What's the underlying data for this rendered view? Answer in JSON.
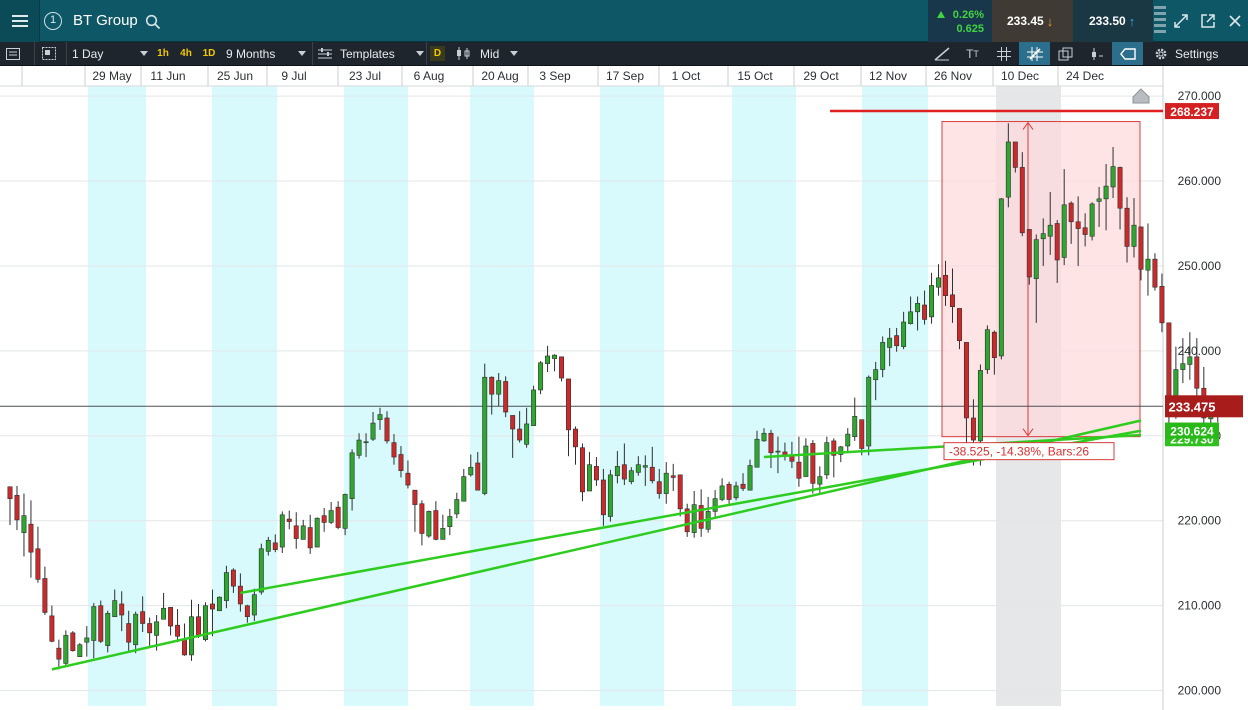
{
  "header": {
    "instrument": "BT Group",
    "link_badge": "1",
    "change_pct": "0.26%",
    "change_abs": "0.625",
    "sell_price": "233.45",
    "buy_price": "233.50",
    "icons": [
      "menu-icon",
      "link-icon",
      "search-icon",
      "grip-icon",
      "expand-icon",
      "popout-icon",
      "close-icon"
    ],
    "colors": {
      "header_bg": "#0d5766",
      "positive": "#42d442",
      "sell_bg": "#3f3a33",
      "buy_bg": "#1a3744"
    }
  },
  "toolbar": {
    "interval": "1 Day",
    "quick_intervals": [
      "1h",
      "4h",
      "1D"
    ],
    "range": "9 Months",
    "templates_label": "Templates",
    "price_type_badge": "D",
    "price_type": "Mid",
    "settings_label": "Settings",
    "tools": [
      "draw-line-icon",
      "text-size-icon",
      "grid-icon",
      "crosshair-icon",
      "layers-icon",
      "indicator-icon",
      "label-icon",
      "gear-icon"
    ]
  },
  "chart_data": {
    "type": "candlestick",
    "x_labels": [
      "29 May",
      "11 Jun",
      "25 Jun",
      "9 Jul",
      "23 Jul",
      "6 Aug",
      "20 Aug",
      "3 Sep",
      "17 Sep",
      "1 Oct",
      "15 Oct",
      "29 Oct",
      "12 Nov",
      "26 Nov",
      "10 Dec",
      "24 Dec"
    ],
    "y_ticks": [
      "270.000",
      "260.000",
      "250.000",
      "240.000",
      "230.000",
      "220.000",
      "210.000",
      "200.000"
    ],
    "ylim": [
      199.6,
      272.6
    ],
    "bars_total": 162,
    "current_price": 233.475,
    "current_price_label": "233.475",
    "colors": {
      "up": "#2fa62f",
      "down": "#cc2a2a",
      "band": "#d8fafd",
      "trendline": "#2ecc1e",
      "resistance": "#e02020",
      "measure_fill": "#ffd9dd",
      "measure_border": "#d83c3c"
    },
    "candles": [
      [
        224.0,
        224.0,
        219.5,
        222.6
      ],
      [
        223.0,
        224.1,
        218.9,
        220.1
      ],
      [
        218.6,
        223.2,
        215.8,
        220.6
      ],
      [
        219.6,
        222.4,
        213.3,
        216.3
      ],
      [
        216.7,
        219.3,
        212.7,
        213.1
      ],
      [
        213.2,
        214.6,
        208.9,
        209.2
      ],
      [
        208.8,
        210.0,
        205.7,
        205.8
      ],
      [
        205.0,
        206.0,
        202.5,
        203.7
      ],
      [
        203.2,
        207.1,
        202.8,
        206.5
      ],
      [
        206.8,
        207.0,
        204.6,
        204.7
      ],
      [
        204.0,
        205.6,
        204.6,
        205.4
      ],
      [
        205.7,
        207.6,
        204.0,
        206.2
      ],
      [
        205.9,
        210.3,
        203.8,
        209.9
      ],
      [
        210.0,
        210.6,
        205.6,
        205.8
      ],
      [
        205.3,
        209.4,
        204.5,
        209.1
      ],
      [
        208.7,
        211.9,
        209.4,
        210.6
      ],
      [
        210.2,
        211.7,
        207.0,
        208.9
      ],
      [
        207.9,
        209.4,
        204.7,
        205.7
      ],
      [
        205.4,
        209.3,
        204.4,
        209.0
      ],
      [
        209.3,
        211.1,
        206.9,
        207.9
      ],
      [
        207.9,
        208.6,
        205.0,
        206.8
      ],
      [
        206.5,
        208.9,
        204.7,
        208.1
      ],
      [
        208.4,
        211.5,
        208.4,
        209.7
      ],
      [
        209.8,
        209.8,
        206.5,
        207.6
      ],
      [
        207.7,
        209.6,
        205.7,
        206.4
      ],
      [
        206.1,
        207.9,
        204.1,
        204.2
      ],
      [
        204.2,
        210.7,
        203.5,
        208.7
      ],
      [
        208.7,
        210.2,
        206.2,
        206.4
      ],
      [
        206.0,
        210.4,
        205.8,
        210.0
      ],
      [
        210.2,
        211.9,
        206.4,
        209.6
      ],
      [
        209.4,
        211.1,
        209.9,
        211.0
      ],
      [
        210.6,
        214.7,
        209.7,
        213.9
      ],
      [
        214.2,
        214.4,
        211.5,
        212.3
      ],
      [
        212.3,
        213.8,
        209.3,
        210.2
      ],
      [
        210.0,
        210.1,
        208.0,
        208.7
      ],
      [
        208.9,
        212.0,
        208.2,
        211.3
      ],
      [
        211.6,
        217.3,
        211.3,
        216.7
      ],
      [
        216.4,
        218.1,
        215.9,
        217.7
      ],
      [
        217.4,
        218.4,
        216.3,
        216.6
      ],
      [
        216.9,
        221.1,
        216.2,
        220.7
      ],
      [
        220.2,
        221.2,
        219.0,
        219.9
      ],
      [
        219.4,
        221.0,
        216.7,
        217.9
      ],
      [
        217.8,
        220.1,
        218.1,
        219.4
      ],
      [
        219.2,
        220.7,
        216.1,
        216.8
      ],
      [
        216.9,
        220.4,
        216.9,
        220.3
      ],
      [
        220.6,
        221.5,
        218.7,
        219.8
      ],
      [
        219.8,
        222.2,
        219.6,
        221.2
      ],
      [
        221.6,
        222.3,
        219.0,
        219.2
      ],
      [
        219.1,
        223.2,
        218.3,
        223.1
      ],
      [
        222.6,
        228.4,
        221.2,
        228.0
      ],
      [
        227.7,
        230.3,
        227.3,
        229.5
      ],
      [
        229.3,
        230.3,
        227.5,
        229.3
      ],
      [
        229.6,
        232.8,
        229.4,
        231.5
      ],
      [
        231.9,
        233.3,
        230.7,
        232.5
      ],
      [
        232.1,
        232.9,
        229.1,
        229.4
      ],
      [
        229.2,
        230.2,
        226.6,
        227.5
      ],
      [
        227.8,
        228.8,
        225.1,
        225.9
      ],
      [
        225.6,
        227.1,
        223.8,
        224.2
      ],
      [
        223.6,
        223.4,
        218.7,
        221.9
      ],
      [
        222.0,
        222.4,
        217.1,
        218.5
      ],
      [
        218.2,
        221.2,
        218.0,
        221.1
      ],
      [
        221.2,
        222.3,
        217.7,
        217.8
      ],
      [
        217.8,
        220.7,
        218.4,
        219.1
      ],
      [
        219.3,
        221.4,
        218.3,
        220.5
      ],
      [
        220.8,
        223.3,
        220.3,
        222.5
      ],
      [
        222.3,
        226.1,
        222.3,
        225.2
      ],
      [
        225.4,
        227.8,
        225.2,
        226.3
      ],
      [
        226.8,
        228.1,
        223.6,
        223.6
      ],
      [
        223.2,
        238.5,
        223.0,
        236.9
      ],
      [
        236.9,
        237.0,
        232.5,
        234.9
      ],
      [
        234.9,
        237.4,
        233.5,
        236.5
      ],
      [
        236.4,
        237.0,
        232.2,
        232.8
      ],
      [
        232.4,
        232.0,
        227.4,
        230.8
      ],
      [
        230.8,
        232.9,
        229.2,
        229.5
      ],
      [
        229.0,
        233.3,
        228.6,
        231.4
      ],
      [
        231.2,
        235.9,
        231.4,
        235.4
      ],
      [
        235.4,
        238.8,
        234.9,
        238.6
      ],
      [
        238.5,
        240.6,
        237.5,
        239.4
      ],
      [
        239.1,
        239.6,
        237.6,
        239.5
      ],
      [
        239.3,
        239.2,
        236.4,
        236.8
      ],
      [
        236.7,
        231.9,
        227.6,
        230.7
      ],
      [
        230.8,
        231.1,
        226.6,
        228.7
      ],
      [
        228.6,
        229.1,
        222.3,
        223.4
      ],
      [
        223.5,
        228.1,
        225.5,
        226.6
      ],
      [
        226.4,
        227.5,
        224.1,
        224.8
      ],
      [
        224.8,
        226.1,
        219.4,
        220.7
      ],
      [
        220.5,
        226.0,
        219.9,
        225.4
      ],
      [
        225.3,
        228.2,
        224.4,
        226.4
      ],
      [
        226.6,
        229.1,
        224.2,
        224.9
      ],
      [
        224.6,
        226.3,
        224.3,
        225.9
      ],
      [
        225.7,
        227.6,
        225.3,
        226.6
      ],
      [
        226.3,
        227.7,
        224.1,
        226.5
      ],
      [
        226.3,
        228.7,
        224.4,
        224.7
      ],
      [
        224.6,
        226.1,
        222.6,
        223.2
      ],
      [
        223.2,
        226.9,
        222.0,
        225.6
      ],
      [
        225.3,
        226.7,
        223.5,
        225.1
      ],
      [
        225.4,
        225.2,
        220.5,
        221.4
      ],
      [
        221.4,
        222.0,
        218.1,
        218.7
      ],
      [
        218.6,
        223.5,
        218.0,
        221.9
      ],
      [
        221.8,
        223.7,
        218.1,
        219.1
      ],
      [
        219.0,
        222.8,
        218.6,
        221.1
      ],
      [
        221.1,
        223.6,
        220.4,
        222.6
      ],
      [
        222.5,
        225.0,
        222.3,
        224.1
      ],
      [
        224.3,
        224.6,
        222.0,
        222.5
      ],
      [
        222.7,
        224.6,
        222.4,
        224.1
      ],
      [
        224.3,
        225.6,
        223.5,
        223.8
      ],
      [
        223.6,
        227.2,
        223.8,
        226.5
      ],
      [
        226.3,
        230.6,
        226.5,
        229.6
      ],
      [
        229.4,
        230.9,
        229.3,
        230.3
      ],
      [
        230.3,
        230.7,
        226.2,
        228.0
      ],
      [
        228.1,
        229.9,
        225.6,
        228.2
      ],
      [
        228.1,
        229.2,
        227.1,
        227.6
      ],
      [
        227.7,
        229.3,
        226.2,
        227.0
      ],
      [
        226.9,
        229.9,
        224.0,
        225.0
      ],
      [
        225.2,
        229.7,
        225.2,
        228.8
      ],
      [
        229.1,
        229.5,
        223.2,
        224.4
      ],
      [
        224.3,
        226.4,
        223.3,
        225.2
      ],
      [
        225.4,
        229.9,
        224.9,
        229.2
      ],
      [
        229.4,
        229.7,
        225.1,
        227.7
      ],
      [
        227.8,
        228.8,
        226.9,
        228.7
      ],
      [
        228.8,
        230.9,
        228.1,
        230.2
      ],
      [
        229.9,
        234.5,
        229.4,
        232.3
      ],
      [
        231.9,
        230.6,
        227.7,
        228.5
      ],
      [
        228.8,
        237.1,
        227.7,
        236.9
      ],
      [
        236.6,
        238.7,
        234.2,
        237.8
      ],
      [
        237.8,
        241.7,
        236.9,
        241.0
      ],
      [
        240.4,
        242.7,
        238.2,
        241.5
      ],
      [
        241.8,
        242.7,
        239.9,
        240.6
      ],
      [
        240.5,
        244.6,
        240.2,
        243.4
      ],
      [
        243.2,
        246.4,
        243.1,
        244.6
      ],
      [
        244.6,
        246.4,
        242.4,
        245.6
      ],
      [
        245.4,
        247.1,
        243.1,
        243.7
      ],
      [
        244.0,
        249.2,
        243.2,
        247.7
      ],
      [
        247.5,
        250.2,
        246.5,
        248.6
      ],
      [
        248.9,
        250.6,
        245.3,
        246.5
      ],
      [
        246.6,
        249.7,
        243.3,
        245.2
      ],
      [
        245.0,
        244.7,
        240.2,
        241.2
      ],
      [
        241.0,
        233.8,
        226.9,
        232.1
      ],
      [
        232.1,
        234.3,
        226.5,
        229.5
      ],
      [
        229.4,
        238.4,
        226.5,
        237.7
      ],
      [
        237.8,
        243.0,
        237.3,
        242.5
      ],
      [
        242.2,
        242.4,
        237.2,
        239.2
      ],
      [
        239.4,
        258.0,
        239.0,
        257.9
      ],
      [
        258.1,
        266.8,
        256.9,
        264.6
      ],
      [
        264.6,
        264.3,
        261.0,
        261.6
      ],
      [
        261.6,
        263.4,
        253.5,
        253.9
      ],
      [
        254.3,
        253.2,
        247.8,
        248.7
      ],
      [
        248.5,
        253.7,
        243.3,
        253.1
      ],
      [
        253.2,
        255.6,
        250.0,
        253.8
      ],
      [
        253.5,
        258.7,
        251.3,
        254.8
      ],
      [
        255.0,
        255.4,
        248.0,
        250.7
      ],
      [
        251.0,
        261.4,
        250.1,
        257.2
      ],
      [
        257.4,
        257.6,
        252.6,
        255.2
      ],
      [
        255.2,
        258.2,
        250.0,
        254.4
      ],
      [
        254.5,
        256.2,
        252.3,
        253.7
      ],
      [
        253.5,
        257.5,
        253.0,
        257.3
      ],
      [
        257.6,
        259.3,
        254.6,
        257.9
      ],
      [
        257.9,
        262.0,
        254.2,
        259.4
      ],
      [
        259.3,
        264.0,
        258.0,
        261.7
      ],
      [
        261.6,
        261.7,
        254.3,
        256.8
      ],
      [
        256.8,
        258.1,
        250.4,
        252.3
      ],
      [
        252.3,
        258.0,
        251.0,
        254.8
      ],
      [
        254.6,
        253.2,
        248.3,
        249.6
      ],
      [
        249.5,
        255.0,
        246.5,
        250.8
      ],
      [
        250.8,
        251.5,
        247.1,
        247.5
      ],
      [
        247.6,
        249.1,
        242.2,
        243.3
      ],
      [
        243.3,
        239.4,
        230.8,
        234.0
      ],
      [
        234.0,
        240.5,
        232.0,
        237.8
      ],
      [
        237.8,
        241.5,
        236.2,
        238.5
      ],
      [
        238.4,
        242.2,
        236.6,
        239.3
      ],
      [
        239.3,
        241.5,
        234.4,
        235.6
      ],
      [
        235.6,
        238.1,
        230.6,
        232.1
      ],
      [
        232.0,
        234.1,
        230.8,
        233.0
      ],
      [
        233.0,
        233.6,
        231.6,
        233.5
      ]
    ],
    "annotations": {
      "resistance_value": 268.237,
      "resistance_label": "268.237",
      "support_value": 229.712,
      "trend_end_label": "230.624",
      "partial_label": "229.730",
      "measure_top": 267.0,
      "measure_bottom": 229.9,
      "measure_text": "-38.525, -14.38%, Bars:26",
      "trendlines": [
        {
          "from_bar": 6,
          "from_value": 202.5,
          "to_bar": 162,
          "to_value": 231.8
        },
        {
          "from_bar": 33,
          "from_value": 211.5,
          "to_bar": 162,
          "to_value": 230.6
        },
        {
          "from_bar": 108,
          "from_value": 227.5,
          "to_bar": 162,
          "to_value": 230.1
        }
      ]
    }
  }
}
